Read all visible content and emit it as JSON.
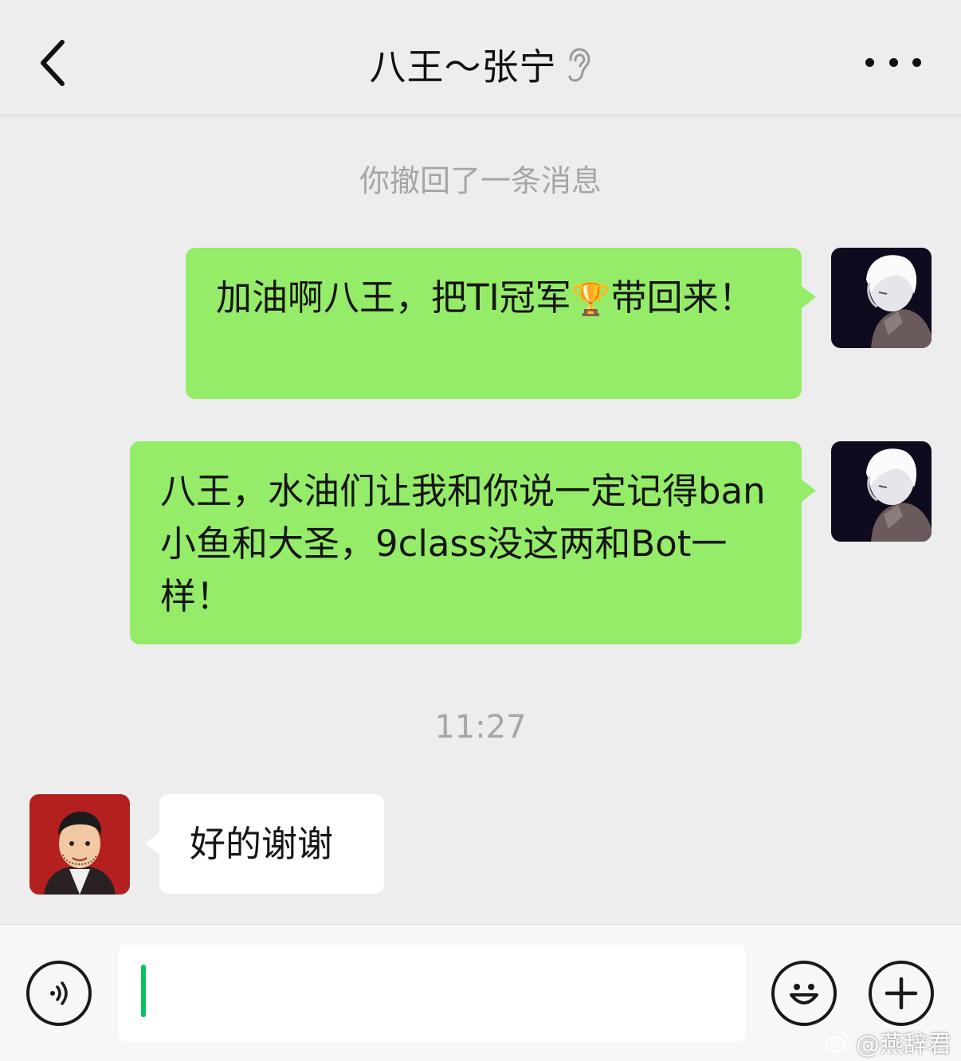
{
  "header": {
    "title": "八王～张宁",
    "back_icon": "chevron-left-icon",
    "mute_icon": "ear-icon",
    "more_icon": "more-dots-icon"
  },
  "system_notice": "你撤回了一条消息",
  "time_stamp": "11:27",
  "messages": [
    {
      "sender": "me",
      "text_before": "加油啊八王，把TI冠军",
      "emoji": "🏆",
      "text_after": "带回来！"
    },
    {
      "sender": "me",
      "text": "八王，水油们让我和你说一定记得ban小鱼和大圣，9class没这两和Bot一样！"
    },
    {
      "sender": "other",
      "text": "好的谢谢"
    }
  ],
  "input_bar": {
    "voice_icon": "voice-icon",
    "emoji_icon": "smiley-icon",
    "plus_icon": "plus-icon",
    "input_value": ""
  },
  "watermark": "@燕辞君",
  "colors": {
    "background": "#ededed",
    "my_bubble": "#95ec69",
    "other_bubble": "#ffffff",
    "cursor": "#07c160",
    "muted_text": "#a6a6a6"
  }
}
